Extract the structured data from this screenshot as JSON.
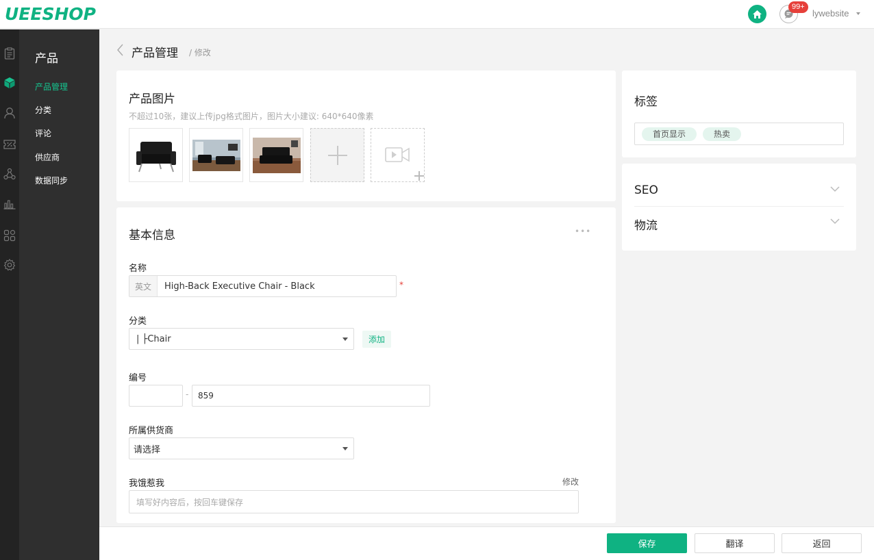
{
  "header": {
    "logo": "UEESHOP",
    "badge": "99+",
    "user": "lywebsite"
  },
  "rail_icons": [
    "clipboard-icon",
    "product-box-icon",
    "user-icon",
    "coupon-icon",
    "network-icon",
    "bar-chart-icon",
    "apps-icon",
    "settings-icon"
  ],
  "submenu": {
    "title": "产品",
    "items": [
      {
        "label": "产品管理"
      },
      {
        "label": "分类"
      },
      {
        "label": "评论"
      },
      {
        "label": "供应商"
      },
      {
        "label": "数据同步"
      }
    ]
  },
  "breadcrumb": {
    "title": "产品管理",
    "sub": "/ 修改"
  },
  "images_card": {
    "title": "产品图片",
    "hint": "不超过10张，建议上传jpg格式图片，图片大小建议: 640*640像素"
  },
  "basic_card": {
    "title": "基本信息",
    "more": "•••",
    "name_label": "名称",
    "lang_tag": "英文",
    "name_value": "High-Back Executive Chair - Black",
    "required": "*",
    "category_label": "分类",
    "category_value": "| ├Chair",
    "add_label": "添加",
    "number_label": "编号",
    "number_prefix": "",
    "number_dash": "-",
    "number_value": "859",
    "supplier_label": "所属供货商",
    "supplier_value": "请选择",
    "keyword_label": "我饿惹我",
    "edit_label": "修改",
    "keyword_placeholder": "填写好内容后，按回车键保存"
  },
  "tags_card": {
    "title": "标签",
    "tags": [
      "首页显示",
      "热卖"
    ]
  },
  "accordions": [
    {
      "label": "SEO"
    },
    {
      "label": "物流"
    }
  ],
  "footer": {
    "save": "保存",
    "translate": "翻译",
    "back": "返回"
  },
  "colors": {
    "accent": "#0fb282",
    "badge": "#e6403a",
    "sidebar_dark": "#232323",
    "submenu_bg": "#2f2f2f"
  }
}
